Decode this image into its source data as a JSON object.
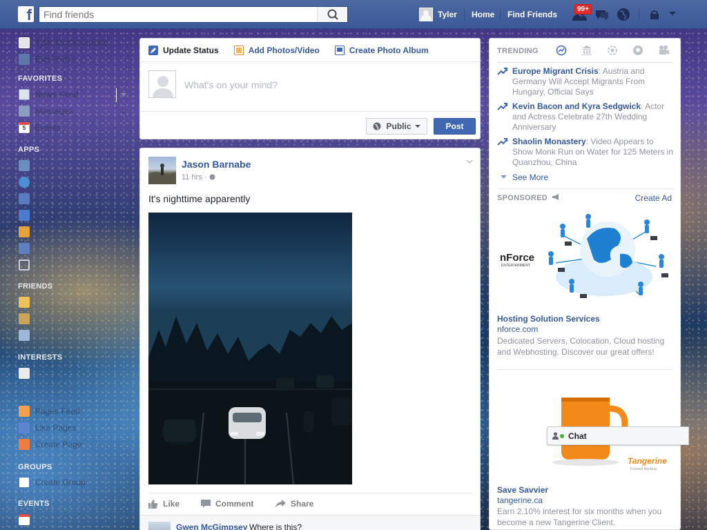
{
  "topbar": {
    "logo_letter": "f",
    "search_placeholder": "Find friends",
    "user_name": "Tyler",
    "nav_home": "Home",
    "nav_find_friends": "Find Friends",
    "notification_count": "99+"
  },
  "sidebar": {
    "profile_name": "Tyler McStreamside",
    "edit_profile": "Edit Profile",
    "favorites_head": "FAVORITES",
    "favorites": [
      {
        "label": "News Feed",
        "icon": "news-feed-icon"
      },
      {
        "label": "Messages",
        "icon": "messages-icon",
        "count": "2"
      },
      {
        "label": "Events",
        "icon": "events-icon",
        "date": "5"
      }
    ],
    "apps_head": "APPS",
    "friends_head": "FRIENDS",
    "interests_head": "INTERESTS",
    "pages_items": [
      "Pages Feed",
      "Like Pages",
      "Create Page"
    ],
    "groups_head": "GROUPS",
    "groups_item": "Create Group",
    "events_head": "EVENTS"
  },
  "composer": {
    "tab_status": "Update Status",
    "tab_photos": "Add Photos/Video",
    "tab_album": "Create Photo Album",
    "placeholder": "What's on your mind?",
    "audience": "Public",
    "post_button": "Post"
  },
  "post": {
    "author": "Jason Barnabe",
    "time": "11 hrs · ",
    "text": "It's nighttime apparently",
    "actions": {
      "like": "Like",
      "comment": "Comment",
      "share": "Share"
    },
    "comment": {
      "name": "Gwen McGimpsey",
      "text": "Where is this?"
    }
  },
  "trending": {
    "head": "TRENDING",
    "items": [
      {
        "title": "Europe Migrant Crisis",
        "desc": ": Austria and Germany Will Accept Migrants From Hungary, Official Says"
      },
      {
        "title": "Kevin Bacon and Kyra Sedgwick",
        "desc": ": Actor and Actress Celebrate 27th Wedding Anniversary"
      },
      {
        "title": "Shaolin Monastery",
        "desc": ": Video Appears to Show Monk Run on Water for 125 Meters in Quanzhou, China"
      }
    ],
    "see_more": "See More"
  },
  "sponsored": {
    "head": "SPONSORED",
    "create_ad": "Create Ad",
    "ads": [
      {
        "brand": "nForce",
        "brand_sub": "ENTERTAINMENT",
        "title": "Hosting Solution Services",
        "domain": "nforce.com",
        "desc": "Dedicated Servers, Colocation, Cloud hosting and Webhosting. Discover our great offers!"
      },
      {
        "brand": "Tangerine",
        "brand_sub": "Forward Banking",
        "title": "Save Savvier",
        "domain": "tangerine.ca",
        "desc": "Earn 2.10% interest for six months when you become a new Tangerine Client."
      }
    ]
  },
  "chat": {
    "label": "Chat"
  },
  "colors": {
    "brand": "#3b5998",
    "link": "#365899",
    "button": "#4267b2",
    "badge": "#e02d2d"
  }
}
